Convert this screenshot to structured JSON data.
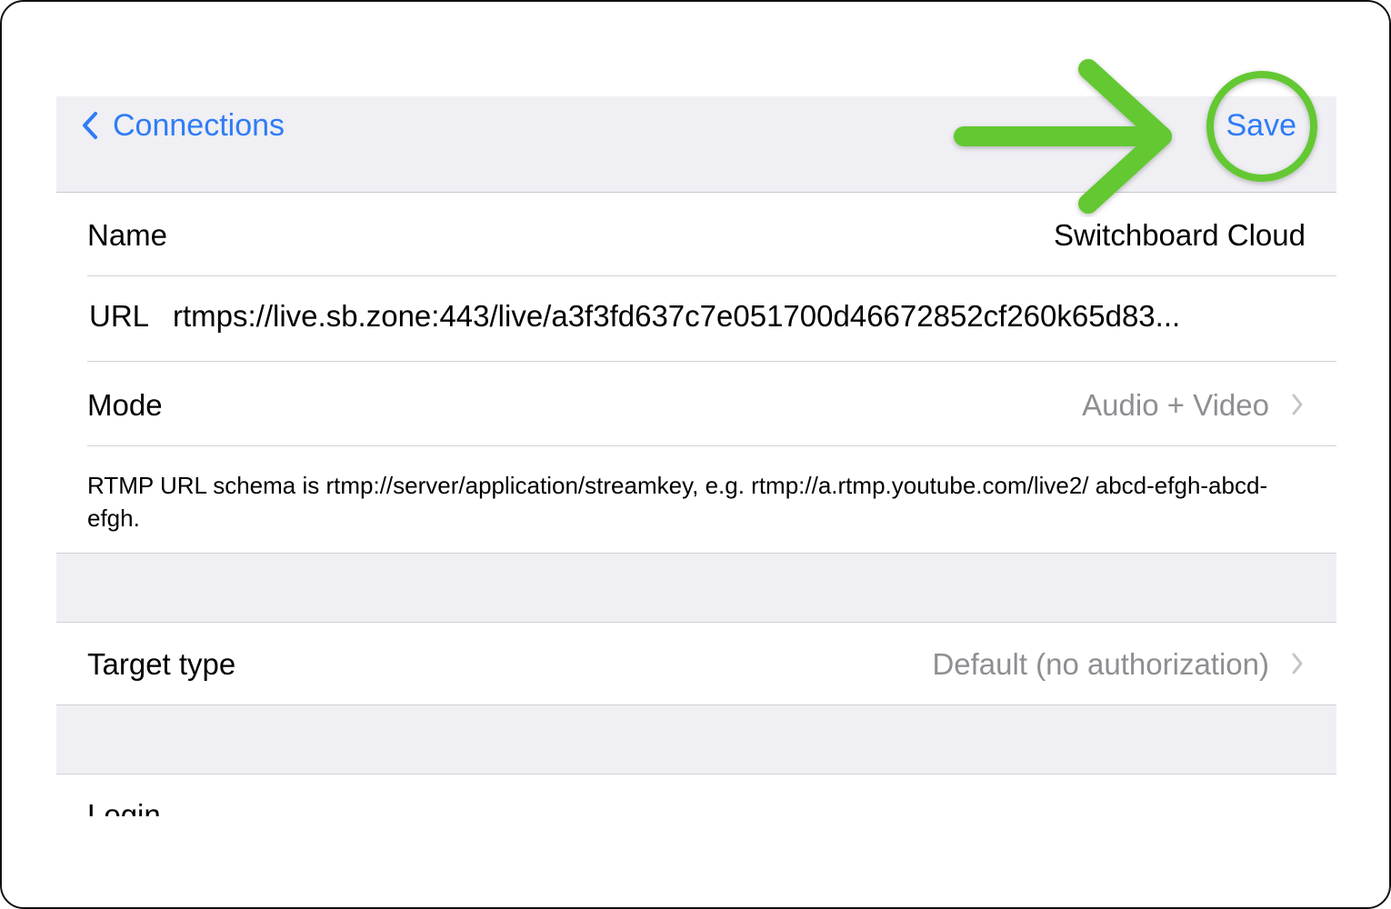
{
  "navbar": {
    "back_label": "Connections",
    "save_label": "Save"
  },
  "form": {
    "name": {
      "label": "Name",
      "value": "Switchboard Cloud"
    },
    "url": {
      "label": "URL",
      "value": "rtmps://live.sb.zone:443/live/a3f3fd637c7e051700d46672852cf260k65d83..."
    },
    "mode": {
      "label": "Mode",
      "value": "Audio + Video"
    },
    "note": "RTMP URL schema is rtmp://server/application/streamkey, e.g. rtmp://a.rtmp.youtube.com/live2/ abcd-efgh-abcd-efgh.",
    "target_type": {
      "label": "Target type",
      "value": "Default (no authorization)"
    },
    "login": {
      "label": "Login"
    }
  },
  "colors": {
    "accent": "#2f7cf6",
    "annotation": "#64c832",
    "secondary_text": "#8e8e93",
    "group_background": "#efeff4"
  }
}
